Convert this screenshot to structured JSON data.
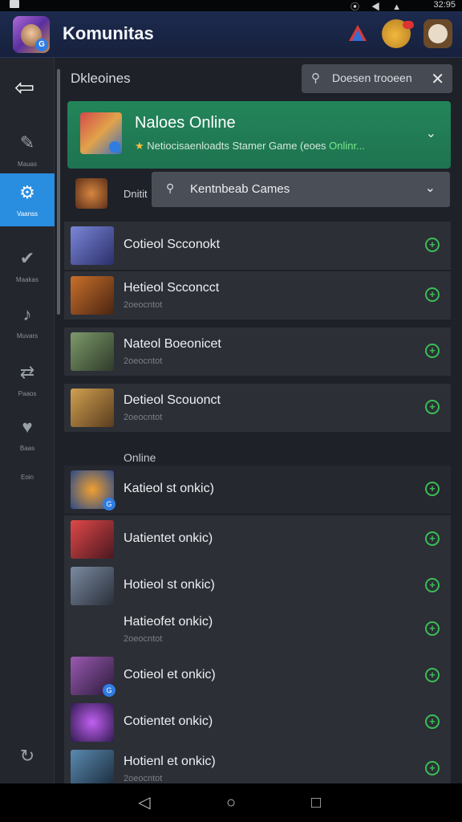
{
  "statusbar": {
    "time": "32:95",
    "icons": "⦿ ◀ ▲"
  },
  "app": {
    "title": "Komunitas"
  },
  "sidebar": {
    "items": [
      {
        "name": "sidebar-item-1",
        "label": "Mauas",
        "icon": "✎"
      },
      {
        "name": "sidebar-item-2",
        "label": "Vaanss",
        "icon": "⚙"
      },
      {
        "name": "sidebar-item-3",
        "label": "Maakas",
        "icon": "✔"
      },
      {
        "name": "sidebar-item-4",
        "label": "Muvars",
        "icon": "♪"
      },
      {
        "name": "sidebar-item-5",
        "label": "Paaos",
        "icon": "⇄"
      },
      {
        "name": "sidebar-item-6",
        "label": "Baas",
        "icon": "♥"
      },
      {
        "name": "sidebar-item-7",
        "label": "Eoin",
        "icon": ""
      }
    ]
  },
  "main": {
    "section_title": "Dkleoines",
    "search": {
      "value": "Doesen trooeen"
    },
    "featured": {
      "title": "Naloes Online",
      "subtitle_prefix": "Netiocisaenloadts Stamer Game (eoes ",
      "subtitle_highlight": "Onlinr..."
    },
    "online_label_short": "Dnitit",
    "dropdown": {
      "value": "Kentnbeab Cames"
    },
    "rows_group1": [
      {
        "name": "Cotieol Scconokt",
        "meta": ""
      },
      {
        "name": "Hetieol Scconcct",
        "meta": "2oeocntot"
      },
      {
        "name": "Nateol Boeonicet",
        "meta": "2oeocntot"
      },
      {
        "name": "Detieol Scouonct",
        "meta": "2oeocntot"
      }
    ],
    "group2_label": "Online",
    "rows_group2": [
      {
        "name": "Katieol st onkic)",
        "meta": ""
      },
      {
        "name": "Uatientet onkic)",
        "meta": ""
      },
      {
        "name": "Hotieol st onkic)",
        "meta": ""
      },
      {
        "name": "Hatieofet onkic)",
        "meta": "2oeocntot"
      },
      {
        "name": "Cotieol et onkic)",
        "meta": ""
      },
      {
        "name": "Cotientet onkic)",
        "meta": ""
      },
      {
        "name": "Hotienl et onkic)",
        "meta": "2oeocntot"
      }
    ]
  },
  "colors": {
    "accent": "#2a8ee0",
    "featured": "#23855a",
    "online": "#3bbd55"
  }
}
